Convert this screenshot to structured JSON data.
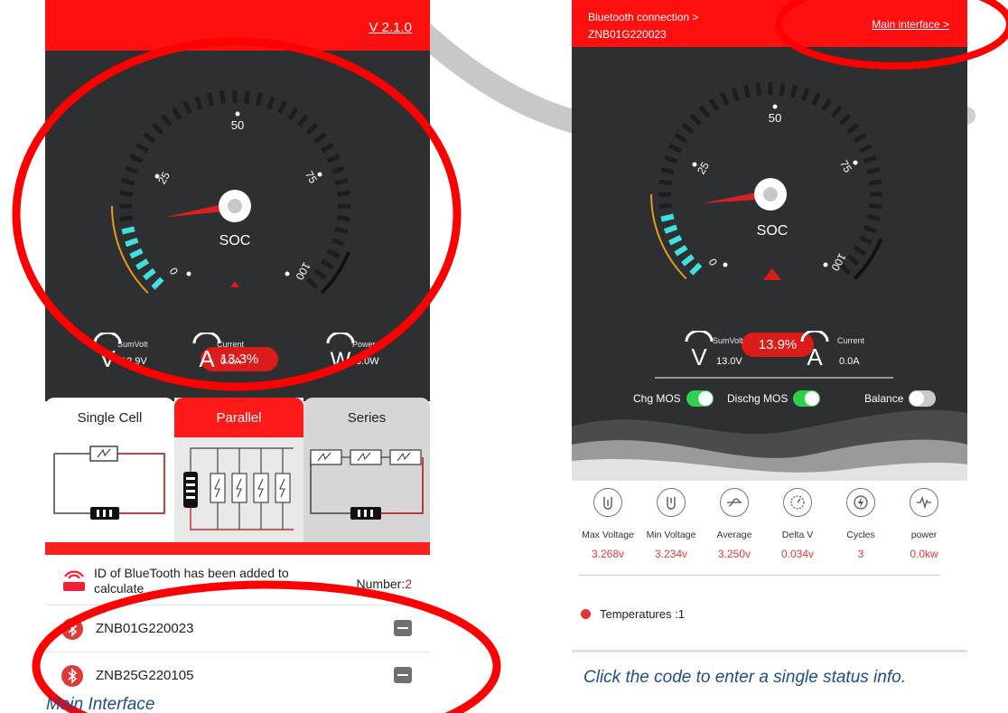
{
  "left_screen": {
    "version": "V 2.1.0",
    "gauge": {
      "ticks": [
        "0",
        "25",
        "50",
        "75",
        "100"
      ],
      "label": "SOC",
      "value_text": "13.3%",
      "soc": 0.133
    },
    "metrics": [
      {
        "name": "SumVolt",
        "value": "12.9V",
        "glyph": "V"
      },
      {
        "name": "Current",
        "value": "0.0A",
        "glyph": "A"
      },
      {
        "name": "Power",
        "value": "0.0W",
        "glyph": "W"
      }
    ],
    "tabs": [
      {
        "label": "Single Cell",
        "active": false
      },
      {
        "label": "Parallel",
        "active": true
      },
      {
        "label": "Series",
        "active": false
      }
    ],
    "id_text": "ID of BlueTooth has been added to calculate",
    "number_label": "Number:",
    "number_value": "2",
    "devices": [
      "ZNB01G220023",
      "ZNB25G220105"
    ]
  },
  "right_screen": {
    "bt_link_line1": "Bluetooth connection >",
    "bt_link_line2": "ZNB01G220023",
    "main_link": "Main interface >",
    "gauge": {
      "ticks": [
        "0",
        "25",
        "50",
        "75",
        "100"
      ],
      "label": "SOC",
      "value_text": "13.9%",
      "soc": 0.139
    },
    "metrics": [
      {
        "name": "SumVolt",
        "value": "13.0V",
        "glyph": "V"
      },
      {
        "name": "Current",
        "value": "0.0A",
        "glyph": "A"
      }
    ],
    "mos": [
      {
        "label": "Chg MOS",
        "on": true
      },
      {
        "label": "Dischg MOS",
        "on": true
      },
      {
        "label": "Balance",
        "on": false
      }
    ],
    "stats": [
      {
        "name": "Max Voltage",
        "value": "3.268v",
        "icon": "max-voltage-icon"
      },
      {
        "name": "Min Voltage",
        "value": "3.234v",
        "icon": "min-voltage-icon"
      },
      {
        "name": "Average",
        "value": "3.250v",
        "icon": "average-icon"
      },
      {
        "name": "Delta V",
        "value": "0.034v",
        "icon": "delta-v-icon"
      },
      {
        "name": "Cycles",
        "value": "3",
        "icon": "cycles-icon"
      },
      {
        "name": "power",
        "value": "0.0kw",
        "icon": "power-icon"
      }
    ],
    "temperatures_label": "Temperatures :1"
  },
  "captions": {
    "left": "Main Interface",
    "right": "Click the code to enter a single status info."
  },
  "colors": {
    "brand_red": "#ff1010",
    "dark_bg": "#2e2f31",
    "gauge_cyan": "#3fe0e0",
    "annotation_red": "#ff0000",
    "caption_blue": "#1f4e8c"
  }
}
